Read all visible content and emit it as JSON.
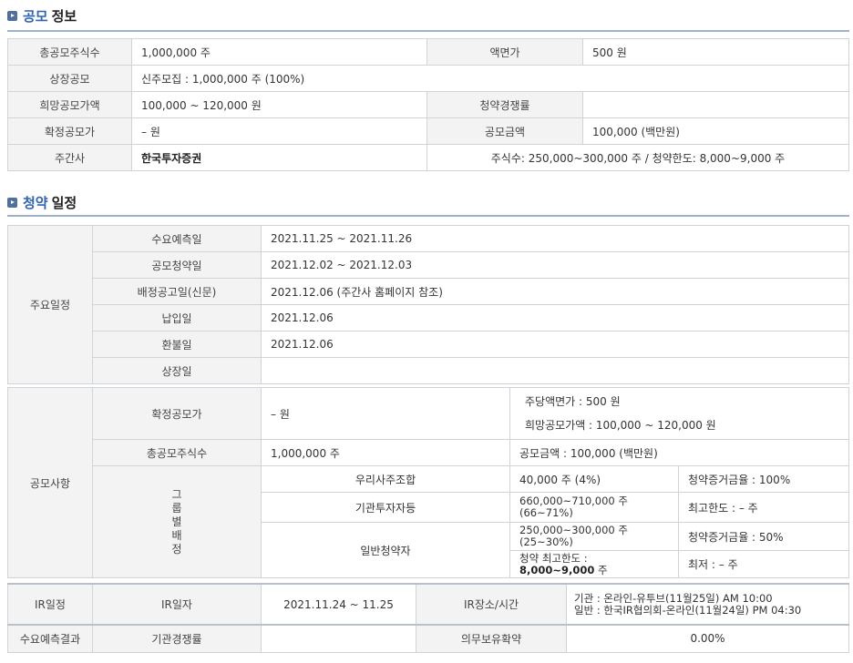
{
  "sections": {
    "offering": {
      "title_accent": "공모",
      "title_rest": "정보"
    },
    "schedule": {
      "title_accent": "청약",
      "title_rest": "일정"
    }
  },
  "offering_info": {
    "total_shares_label": "총공모주식수",
    "total_shares": "1,000,000 주",
    "par_label": "액면가",
    "par": "500 원",
    "listing_label": "상장공모",
    "listing": "신주모집 : 1,000,000 주 (100%)",
    "hope_price_label": "희망공모가액",
    "hope_price": "100,000 ~ 120,000 원",
    "competition_label": "청약경쟁률",
    "competition": "",
    "final_price_label": "확정공모가",
    "final_price": "– 원",
    "amount_label": "공모금액",
    "amount": "100,000 (백만원)",
    "underwriter_label": "주간사",
    "underwriter": "한국투자증권",
    "underwriter_detail": "주식수: 250,000~300,000 주   /   청약한도: 8,000~9,000 주"
  },
  "schedule": {
    "main_label": "주요일정",
    "rows": [
      {
        "label": "수요예측일",
        "value": "2021.11.25  ~  2021.11.26"
      },
      {
        "label": "공모청약일",
        "value": "2021.12.02  ~  2021.12.03"
      },
      {
        "label": "배정공고일(신문)",
        "value": "2021.12.06 (주간사 홈페이지 참조)"
      },
      {
        "label": "납입일",
        "value": "2021.12.06"
      },
      {
        "label": "환불일",
        "value": "2021.12.06"
      },
      {
        "label": "상장일",
        "value": ""
      }
    ],
    "offering_label": "공모사항",
    "final_price_label": "확정공모가",
    "final_price": "– 원",
    "par_text": "주당액면가 :  500 원",
    "hope_text": "희망공모가액 :  100,000 ~ 120,000 원",
    "total_shares_label": "총공모주식수",
    "total_shares": "1,000,000 주",
    "amount_text": "공모금액 : 100,000 (백만원)",
    "group_label": "그룹별배정",
    "groups": [
      {
        "name": "우리사주조합",
        "shares": "40,000 주  (4%)",
        "note": "청약증거금율 : 100%"
      },
      {
        "name": "기관투자자등",
        "shares": "660,000~710,000 주 (66~71%)",
        "note": "최고한도 :  – 주"
      },
      {
        "name": "일반청약자",
        "shares": "250,000~300,000 주 (25~30%)",
        "note": "청약증거금율 : 50%",
        "limit_label": "청약 최고한도 :",
        "limit_value": "8,000~9,000",
        "limit_unit": "주",
        "min_note": "최저 :  – 주"
      }
    ],
    "ir_label": "IR일정",
    "ir_date_label": "IR일자",
    "ir_date": "2021.11.24 ~ 11.25",
    "ir_place_label": "IR장소/시간",
    "ir_place_1": "기관 : 온라인-유투브(11월25일) AM 10:00",
    "ir_place_2": "일반 : 한국IR협의회-온라인(11월24일) PM 04:30",
    "demand_label": "수요예측결과",
    "inst_comp_label": "기관경쟁률",
    "inst_comp": "",
    "lockup_label": "의무보유확약",
    "lockup": "0.00%"
  }
}
